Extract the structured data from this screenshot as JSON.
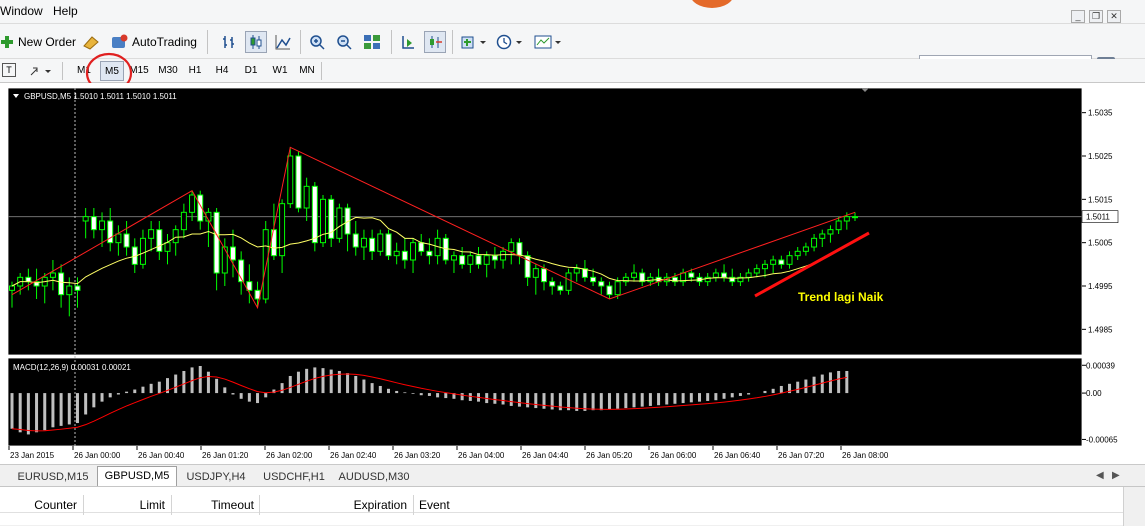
{
  "menu": {
    "window": "Window",
    "help": "Help"
  },
  "toolbar": {
    "new_order": "New Order",
    "autotrading": "AutoTrading"
  },
  "timeframes": [
    "M1",
    "M5",
    "M15",
    "M30",
    "H1",
    "H4",
    "D1",
    "W1",
    "MN"
  ],
  "active_timeframe": "M5",
  "chart": {
    "header": "GBPUSD,M5  1.5010 1.5011 1.5010 1.5011",
    "price_labels": [
      "1.5035",
      "1.5025",
      "1.5015",
      "1.5005",
      "1.4995",
      "1.4985"
    ],
    "current_price": "1.5011",
    "annotation": "Trend lagi Naik",
    "macd_header": "MACD(12,26,9) 0.00031 0.00021",
    "macd_labels": [
      "0.00039",
      "0.00",
      "-0.00065"
    ],
    "time_labels": [
      "23 Jan 2015",
      "26 Jan 00:00",
      "26 Jan 00:40",
      "26 Jan 01:20",
      "26 Jan 02:00",
      "26 Jan 02:40",
      "26 Jan 03:20",
      "26 Jan 04:00",
      "26 Jan 04:40",
      "26 Jan 05:20",
      "26 Jan 06:00",
      "26 Jan 06:40",
      "26 Jan 07:20",
      "26 Jan 08:00"
    ]
  },
  "tabs": [
    "EURUSD,M15",
    "GBPUSD,M5",
    "USDJPY,H4",
    "USDCHF,H1",
    "AUDUSD,M30"
  ],
  "active_tab": "GBPUSD,M5",
  "columns": [
    "Counter",
    "Limit",
    "Timeout",
    "Expiration",
    "Event"
  ],
  "colors": {
    "candle": "#00ff00",
    "zigzag": "#ff2020",
    "ma": "#ffff66",
    "macd_hist": "#c0c0c0",
    "macd_signal": "#ff0000",
    "annotation": "#ffff00"
  },
  "price_series": [
    [
      1.4994,
      1.4996,
      1.499,
      1.4995
    ],
    [
      1.4995,
      1.4998,
      1.4993,
      1.4997
    ],
    [
      1.4997,
      1.4999,
      1.4994,
      1.4996
    ],
    [
      1.4996,
      1.4999,
      1.4992,
      1.4995
    ],
    [
      1.4995,
      1.4998,
      1.4991,
      1.4997
    ],
    [
      1.4997,
      1.5001,
      1.4994,
      1.4998
    ],
    [
      1.4998,
      1.5,
      1.499,
      1.4993
    ],
    [
      1.4993,
      1.4997,
      1.4988,
      1.4995
    ],
    [
      1.4995,
      1.4997,
      1.499,
      1.4994
    ],
    [
      1.501,
      1.5013,
      1.5006,
      1.5011
    ],
    [
      1.5011,
      1.5013,
      1.5006,
      1.5008
    ],
    [
      1.5008,
      1.5012,
      1.5004,
      1.501
    ],
    [
      1.501,
      1.5013,
      1.5003,
      1.5005
    ],
    [
      1.5005,
      1.5009,
      1.5002,
      1.5007
    ],
    [
      1.5007,
      1.501,
      1.5002,
      1.5004
    ],
    [
      1.5004,
      1.5006,
      1.4998,
      1.5
    ],
    [
      1.5,
      1.5008,
      1.4999,
      1.5006
    ],
    [
      1.5006,
      1.501,
      1.5003,
      1.5008
    ],
    [
      1.5008,
      1.501,
      1.5001,
      1.5003
    ],
    [
      1.5003,
      1.5007,
      1.5,
      1.5005
    ],
    [
      1.5005,
      1.5009,
      1.5002,
      1.5008
    ],
    [
      1.5008,
      1.5014,
      1.5006,
      1.5012
    ],
    [
      1.5012,
      1.5017,
      1.501,
      1.5016
    ],
    [
      1.5016,
      1.5017,
      1.5008,
      1.501
    ],
    [
      1.501,
      1.5013,
      1.5004,
      1.5012
    ],
    [
      1.5012,
      1.5013,
      1.4994,
      1.4998
    ],
    [
      1.4998,
      1.5006,
      1.4995,
      1.5004
    ],
    [
      1.5004,
      1.5008,
      1.4997,
      1.5001
    ],
    [
      1.5001,
      1.5003,
      1.4993,
      1.4996
    ],
    [
      1.4996,
      1.5,
      1.4991,
      1.4994
    ],
    [
      1.4994,
      1.4996,
      1.499,
      1.4992
    ],
    [
      1.4992,
      1.501,
      1.4991,
      1.5008
    ],
    [
      1.5008,
      1.5014,
      1.5001,
      1.5002
    ],
    [
      1.5002,
      1.5015,
      1.4998,
      1.5014
    ],
    [
      1.5014,
      1.5027,
      1.5013,
      1.5025
    ],
    [
      1.5025,
      1.5026,
      1.5012,
      1.5013
    ],
    [
      1.5013,
      1.502,
      1.501,
      1.5018
    ],
    [
      1.5018,
      1.5019,
      1.5003,
      1.5005
    ],
    [
      1.5005,
      1.5016,
      1.5004,
      1.5015
    ],
    [
      1.5015,
      1.5016,
      1.5004,
      1.5006
    ],
    [
      1.5006,
      1.5014,
      1.5005,
      1.5013
    ],
    [
      1.5013,
      1.5014,
      1.5003,
      1.5007
    ],
    [
      1.5007,
      1.501,
      1.5002,
      1.5004
    ],
    [
      1.5004,
      1.5008,
      1.5001,
      1.5006
    ],
    [
      1.5006,
      1.5008,
      1.5001,
      1.5003
    ],
    [
      1.5003,
      1.5008,
      1.5002,
      1.5007
    ],
    [
      1.5007,
      1.5008,
      1.5001,
      1.5002
    ],
    [
      1.5002,
      1.5005,
      1.5,
      1.5003
    ],
    [
      1.5003,
      1.5006,
      1.4999,
      1.5001
    ],
    [
      1.5001,
      1.5006,
      1.4998,
      1.5005
    ],
    [
      1.5005,
      1.5007,
      1.5002,
      1.5003
    ],
    [
      1.5003,
      1.5006,
      1.5,
      1.5002
    ],
    [
      1.5002,
      1.5008,
      1.5,
      1.5006
    ],
    [
      1.5006,
      1.5007,
      1.5,
      1.5001
    ],
    [
      1.5001,
      1.5003,
      1.4998,
      1.5002
    ],
    [
      1.5002,
      1.5004,
      1.4999,
      1.5
    ],
    [
      1.5,
      1.5003,
      1.4998,
      1.5002
    ],
    [
      1.5002,
      1.5004,
      1.4999,
      1.5
    ],
    [
      1.5,
      1.5003,
      1.4997,
      1.5002
    ],
    [
      1.5002,
      1.5004,
      1.4999,
      1.5001
    ],
    [
      1.5001,
      1.5004,
      1.4999,
      1.5003
    ],
    [
      1.5003,
      1.5006,
      1.5,
      1.5005
    ],
    [
      1.5005,
      1.5006,
      1.5,
      1.5002
    ],
    [
      1.5002,
      1.5003,
      1.4995,
      1.4997
    ],
    [
      1.4997,
      1.5,
      1.4993,
      1.4999
    ],
    [
      1.4999,
      1.5,
      1.4994,
      1.4996
    ],
    [
      1.4996,
      1.4997,
      1.4993,
      1.4995
    ],
    [
      1.4995,
      1.4996,
      1.4993,
      1.4994
    ],
    [
      1.4994,
      1.4999,
      1.4993,
      1.4998
    ],
    [
      1.4998,
      1.5,
      1.4996,
      1.4999
    ],
    [
      1.4999,
      1.5001,
      1.4996,
      1.4997
    ],
    [
      1.4997,
      1.4999,
      1.4995,
      1.4996
    ],
    [
      1.4996,
      1.4997,
      1.4993,
      1.4995
    ],
    [
      1.4995,
      1.4996,
      1.4992,
      1.4993
    ],
    [
      1.4993,
      1.4997,
      1.4992,
      1.4996
    ],
    [
      1.4996,
      1.4998,
      1.4995,
      1.4997
    ],
    [
      1.4997,
      1.5,
      1.4996,
      1.4998
    ],
    [
      1.4998,
      1.4999,
      1.4995,
      1.4996
    ],
    [
      1.4996,
      1.4998,
      1.4995,
      1.4997
    ],
    [
      1.4997,
      1.4999,
      1.4995,
      1.4996
    ],
    [
      1.4996,
      1.4998,
      1.4995,
      1.4997
    ],
    [
      1.4997,
      1.4998,
      1.4995,
      1.4996
    ],
    [
      1.4996,
      1.4999,
      1.4995,
      1.4998
    ],
    [
      1.4998,
      1.4999,
      1.4996,
      1.4997
    ],
    [
      1.4997,
      1.4998,
      1.4995,
      1.4996
    ],
    [
      1.4996,
      1.4998,
      1.4995,
      1.4997
    ],
    [
      1.4997,
      1.4999,
      1.4996,
      1.4998
    ],
    [
      1.4998,
      1.5,
      1.4996,
      1.4997
    ],
    [
      1.4997,
      1.4999,
      1.4995,
      1.4996
    ],
    [
      1.4996,
      1.4998,
      1.4995,
      1.4997
    ],
    [
      1.4997,
      1.4999,
      1.4996,
      1.4998
    ],
    [
      1.4998,
      1.5,
      1.4997,
      1.4999
    ],
    [
      1.4999,
      1.5001,
      1.4997,
      1.5
    ],
    [
      1.5,
      1.5002,
      1.4998,
      1.5001
    ],
    [
      1.5001,
      1.5002,
      1.4999,
      1.5
    ],
    [
      1.5,
      1.5003,
      1.4999,
      1.5002
    ],
    [
      1.5002,
      1.5004,
      1.5001,
      1.5003
    ],
    [
      1.5003,
      1.5005,
      1.5002,
      1.5004
    ],
    [
      1.5004,
      1.5007,
      1.5003,
      1.5006
    ],
    [
      1.5006,
      1.5008,
      1.5004,
      1.5007
    ],
    [
      1.5007,
      1.5009,
      1.5005,
      1.5008
    ],
    [
      1.5008,
      1.5011,
      1.5007,
      1.501
    ],
    [
      1.501,
      1.5012,
      1.5008,
      1.5011
    ],
    [
      1.5011,
      1.5012,
      1.501,
      1.5011
    ]
  ],
  "macd_series": [
    -0.0005,
    -0.00055,
    -0.00058,
    -0.00055,
    -0.00052,
    -0.00048,
    -0.00046,
    -0.00044,
    -0.00042,
    -0.0003,
    -0.0002,
    -0.00012,
    -6e-05,
    -2e-05,
    2e-05,
    5e-05,
    9e-05,
    0.00013,
    0.00016,
    0.00021,
    0.00026,
    0.00031,
    0.00036,
    0.00038,
    0.0003,
    0.0002,
    8e-05,
    -2e-05,
    -8e-05,
    -0.00012,
    -0.00014,
    -6e-05,
    5e-05,
    0.00014,
    0.00024,
    0.0003,
    0.00034,
    0.00036,
    0.00035,
    0.00033,
    0.00031,
    0.00028,
    0.00024,
    0.00019,
    0.00014,
    0.0001,
    6e-05,
    3e-05,
    1e-05,
    -1e-05,
    -3e-05,
    -4e-05,
    -6e-05,
    -7e-05,
    -8e-05,
    -0.0001,
    -0.00011,
    -0.00012,
    -0.00014,
    -0.00015,
    -0.00016,
    -0.00018,
    -0.00019,
    -0.0002,
    -0.00021,
    -0.00022,
    -0.00023,
    -0.00024,
    -0.00024,
    -0.00025,
    -0.00025,
    -0.00024,
    -0.00024,
    -0.00023,
    -0.00022,
    -0.00021,
    -0.0002,
    -0.00019,
    -0.00018,
    -0.00017,
    -0.00016,
    -0.00015,
    -0.00014,
    -0.00013,
    -0.00012,
    -0.00011,
    -0.0001,
    -8e-05,
    -6e-05,
    -4e-05,
    -2e-05,
    0.0,
    3e-05,
    6e-05,
    0.0001,
    0.00013,
    0.00016,
    0.00019,
    0.00023,
    0.00026,
    0.00029,
    0.00031,
    0.00031
  ]
}
